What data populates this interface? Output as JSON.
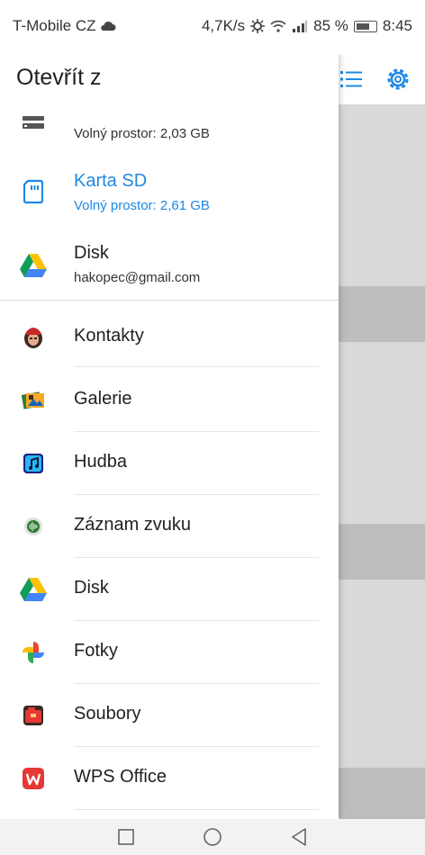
{
  "status_bar": {
    "carrier": "T-Mobile CZ",
    "network_speed": "4,7K/s",
    "battery_percent": "85 %",
    "time": "8:45"
  },
  "drawer": {
    "title": "Otevřít z",
    "storage": [
      {
        "label": "",
        "sub": "Volný prostor: 2,03 GB",
        "icon": "storage-icon"
      },
      {
        "label": "Karta SD",
        "sub": "Volný prostor: 2,61 GB",
        "icon": "sd-card-icon",
        "selected": true
      },
      {
        "label": "Disk",
        "sub": "hakopec@gmail.com",
        "icon": "google-drive-icon"
      }
    ],
    "apps": [
      {
        "label": "Kontakty",
        "icon": "contacts-icon"
      },
      {
        "label": "Galerie",
        "icon": "gallery-icon"
      },
      {
        "label": "Hudba",
        "icon": "music-icon"
      },
      {
        "label": "Záznam zvuku",
        "icon": "sound-recorder-icon"
      },
      {
        "label": "Disk",
        "icon": "google-drive-icon"
      },
      {
        "label": "Fotky",
        "icon": "google-photos-icon"
      },
      {
        "label": "Soubory",
        "icon": "files-icon"
      },
      {
        "label": "WPS Office",
        "icon": "wps-office-icon"
      }
    ]
  },
  "colors": {
    "accent": "#1e88e5",
    "text": "#212121",
    "scrim": "#d9d9d9"
  },
  "nav_bar": {
    "buttons": [
      "recents-button",
      "home-button",
      "back-button"
    ]
  }
}
